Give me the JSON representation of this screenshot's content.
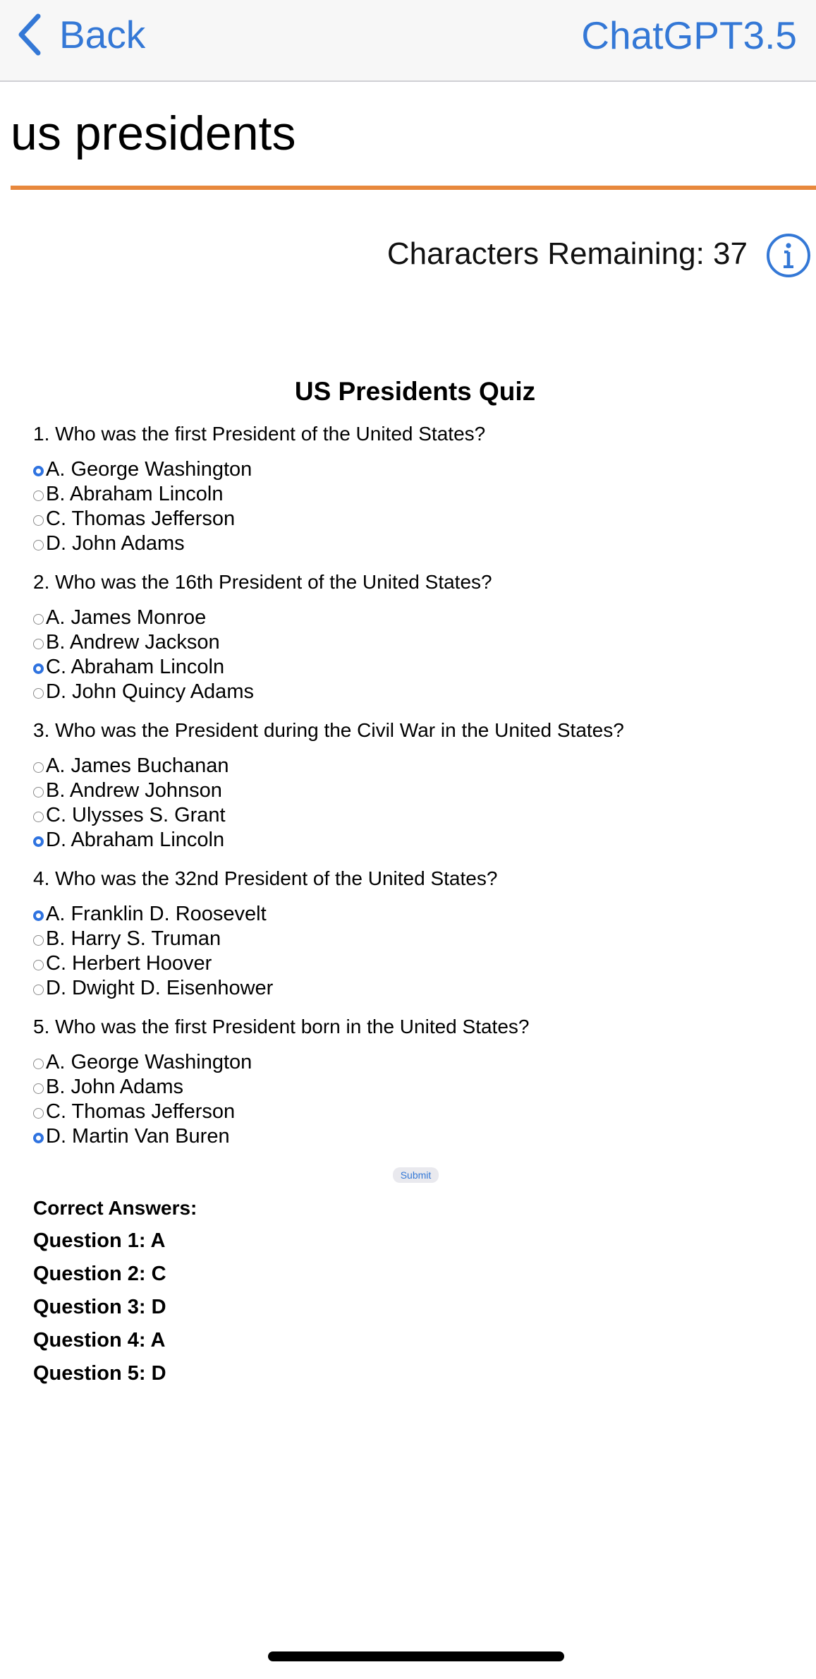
{
  "nav": {
    "back_label": "Back",
    "model_label": "ChatGPT3.5"
  },
  "topic": "us presidents",
  "characters_remaining": "Characters Remaining: 37",
  "quiz": {
    "title": "US Presidents Quiz",
    "questions": [
      {
        "text": "1. Who was the first President of the United States?",
        "options": [
          "A. George Washington",
          "B. Abraham Lincoln",
          "C. Thomas Jefferson",
          "D. John Adams"
        ],
        "selected": 0
      },
      {
        "text": "2. Who was the 16th President of the United States?",
        "options": [
          "A. James Monroe",
          "B. Andrew Jackson",
          "C. Abraham Lincoln",
          "D. John Quincy Adams"
        ],
        "selected": 2
      },
      {
        "text": "3. Who was the President during the Civil War in the United States?",
        "options": [
          "A. James Buchanan",
          "B. Andrew Johnson",
          "C. Ulysses S. Grant",
          "D. Abraham Lincoln"
        ],
        "selected": 3
      },
      {
        "text": "4. Who was the 32nd President of the United States?",
        "options": [
          "A. Franklin D. Roosevelt",
          "B. Harry S. Truman",
          "C. Herbert Hoover",
          "D. Dwight D. Eisenhower"
        ],
        "selected": 0
      },
      {
        "text": "5. Who was the first President born in the United States?",
        "options": [
          "A. George Washington",
          "B. John Adams",
          "C. Thomas Jefferson",
          "D. Martin Van Buren"
        ],
        "selected": 3
      }
    ],
    "submit_label": "Submit",
    "answers_heading": "Correct Answers:",
    "answers": [
      "Question 1: A",
      "Question 2: C",
      "Question 3: D",
      "Question 4: A",
      "Question 5: D"
    ]
  },
  "icons": {
    "back": "chevron-left-icon",
    "info": "info-circle-icon"
  },
  "colors": {
    "accent": "#e8883c",
    "link": "#3478d6",
    "radio_checked": "#2f73e0"
  }
}
